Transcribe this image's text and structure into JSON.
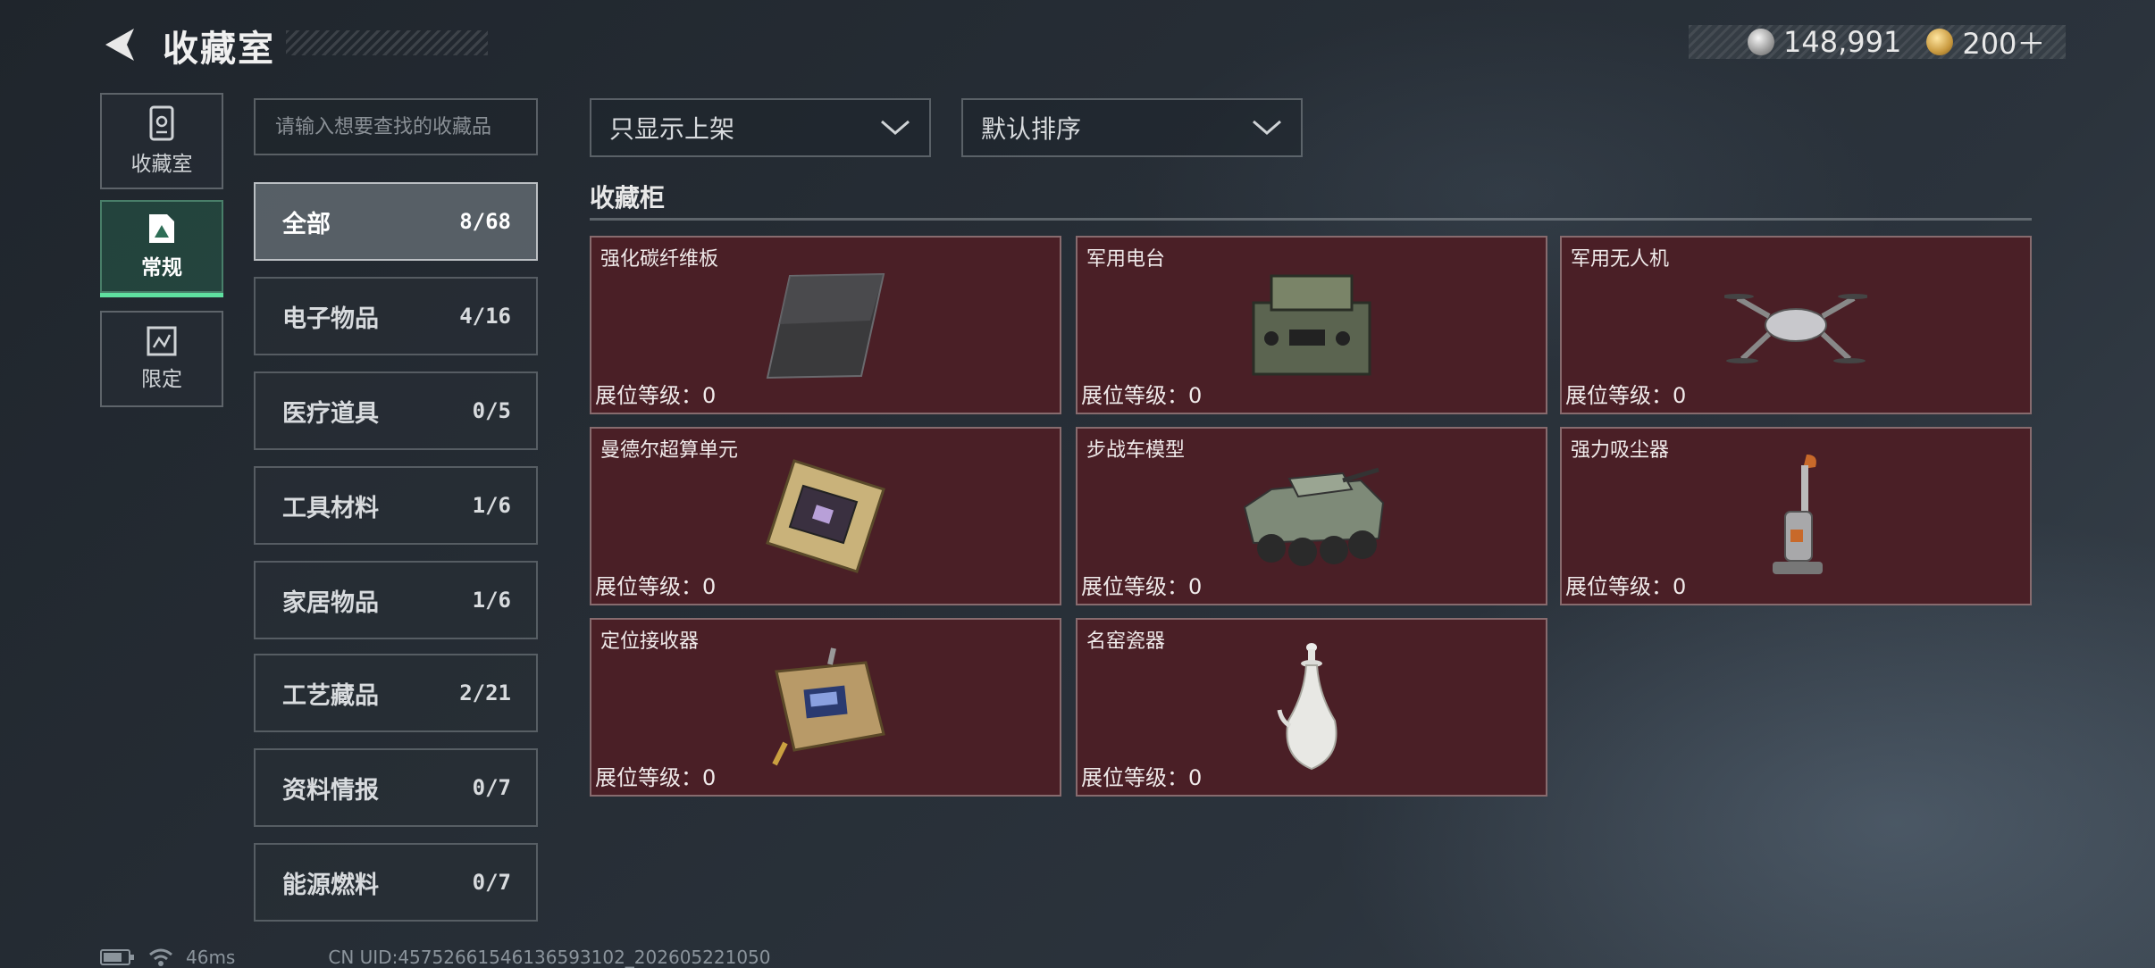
{
  "header": {
    "title": "收藏室",
    "currency_1": "148,991",
    "currency_2": "200＋"
  },
  "nav": {
    "collection_room": "收藏室",
    "regular": "常规",
    "limited": "限定"
  },
  "search": {
    "placeholder": "请输入想要查找的收藏品"
  },
  "categories": [
    {
      "name": "全部",
      "count": "8/68"
    },
    {
      "name": "电子物品",
      "count": "4/16"
    },
    {
      "name": "医疗道具",
      "count": "0/5"
    },
    {
      "name": "工具材料",
      "count": "1/6"
    },
    {
      "name": "家居物品",
      "count": "1/6"
    },
    {
      "name": "工艺藏品",
      "count": "2/21"
    },
    {
      "name": "资料情报",
      "count": "0/7"
    },
    {
      "name": "能源燃料",
      "count": "0/7"
    }
  ],
  "filters": {
    "shelf_filter": "只显示上架",
    "sort": "默认排序"
  },
  "section": {
    "title": "收藏柜"
  },
  "items": [
    {
      "name": "强化碳纤维板",
      "level": "展位等级：0"
    },
    {
      "name": "军用电台",
      "level": "展位等级：0"
    },
    {
      "name": "军用无人机",
      "level": "展位等级：0"
    },
    {
      "name": "曼德尔超算单元",
      "level": "展位等级：0"
    },
    {
      "name": "步战车模型",
      "level": "展位等级：0"
    },
    {
      "name": "强力吸尘器",
      "level": "展位等级：0"
    },
    {
      "name": "定位接收器",
      "level": "展位等级：0"
    },
    {
      "name": "名窑瓷器",
      "level": "展位等级：0"
    }
  ],
  "footer": {
    "ping": "46ms",
    "uid": "CN UID:45752661546136593102_202605221050"
  },
  "colors": {
    "card_bg": "#4a1f26",
    "active_accent": "#5fe0a0"
  }
}
